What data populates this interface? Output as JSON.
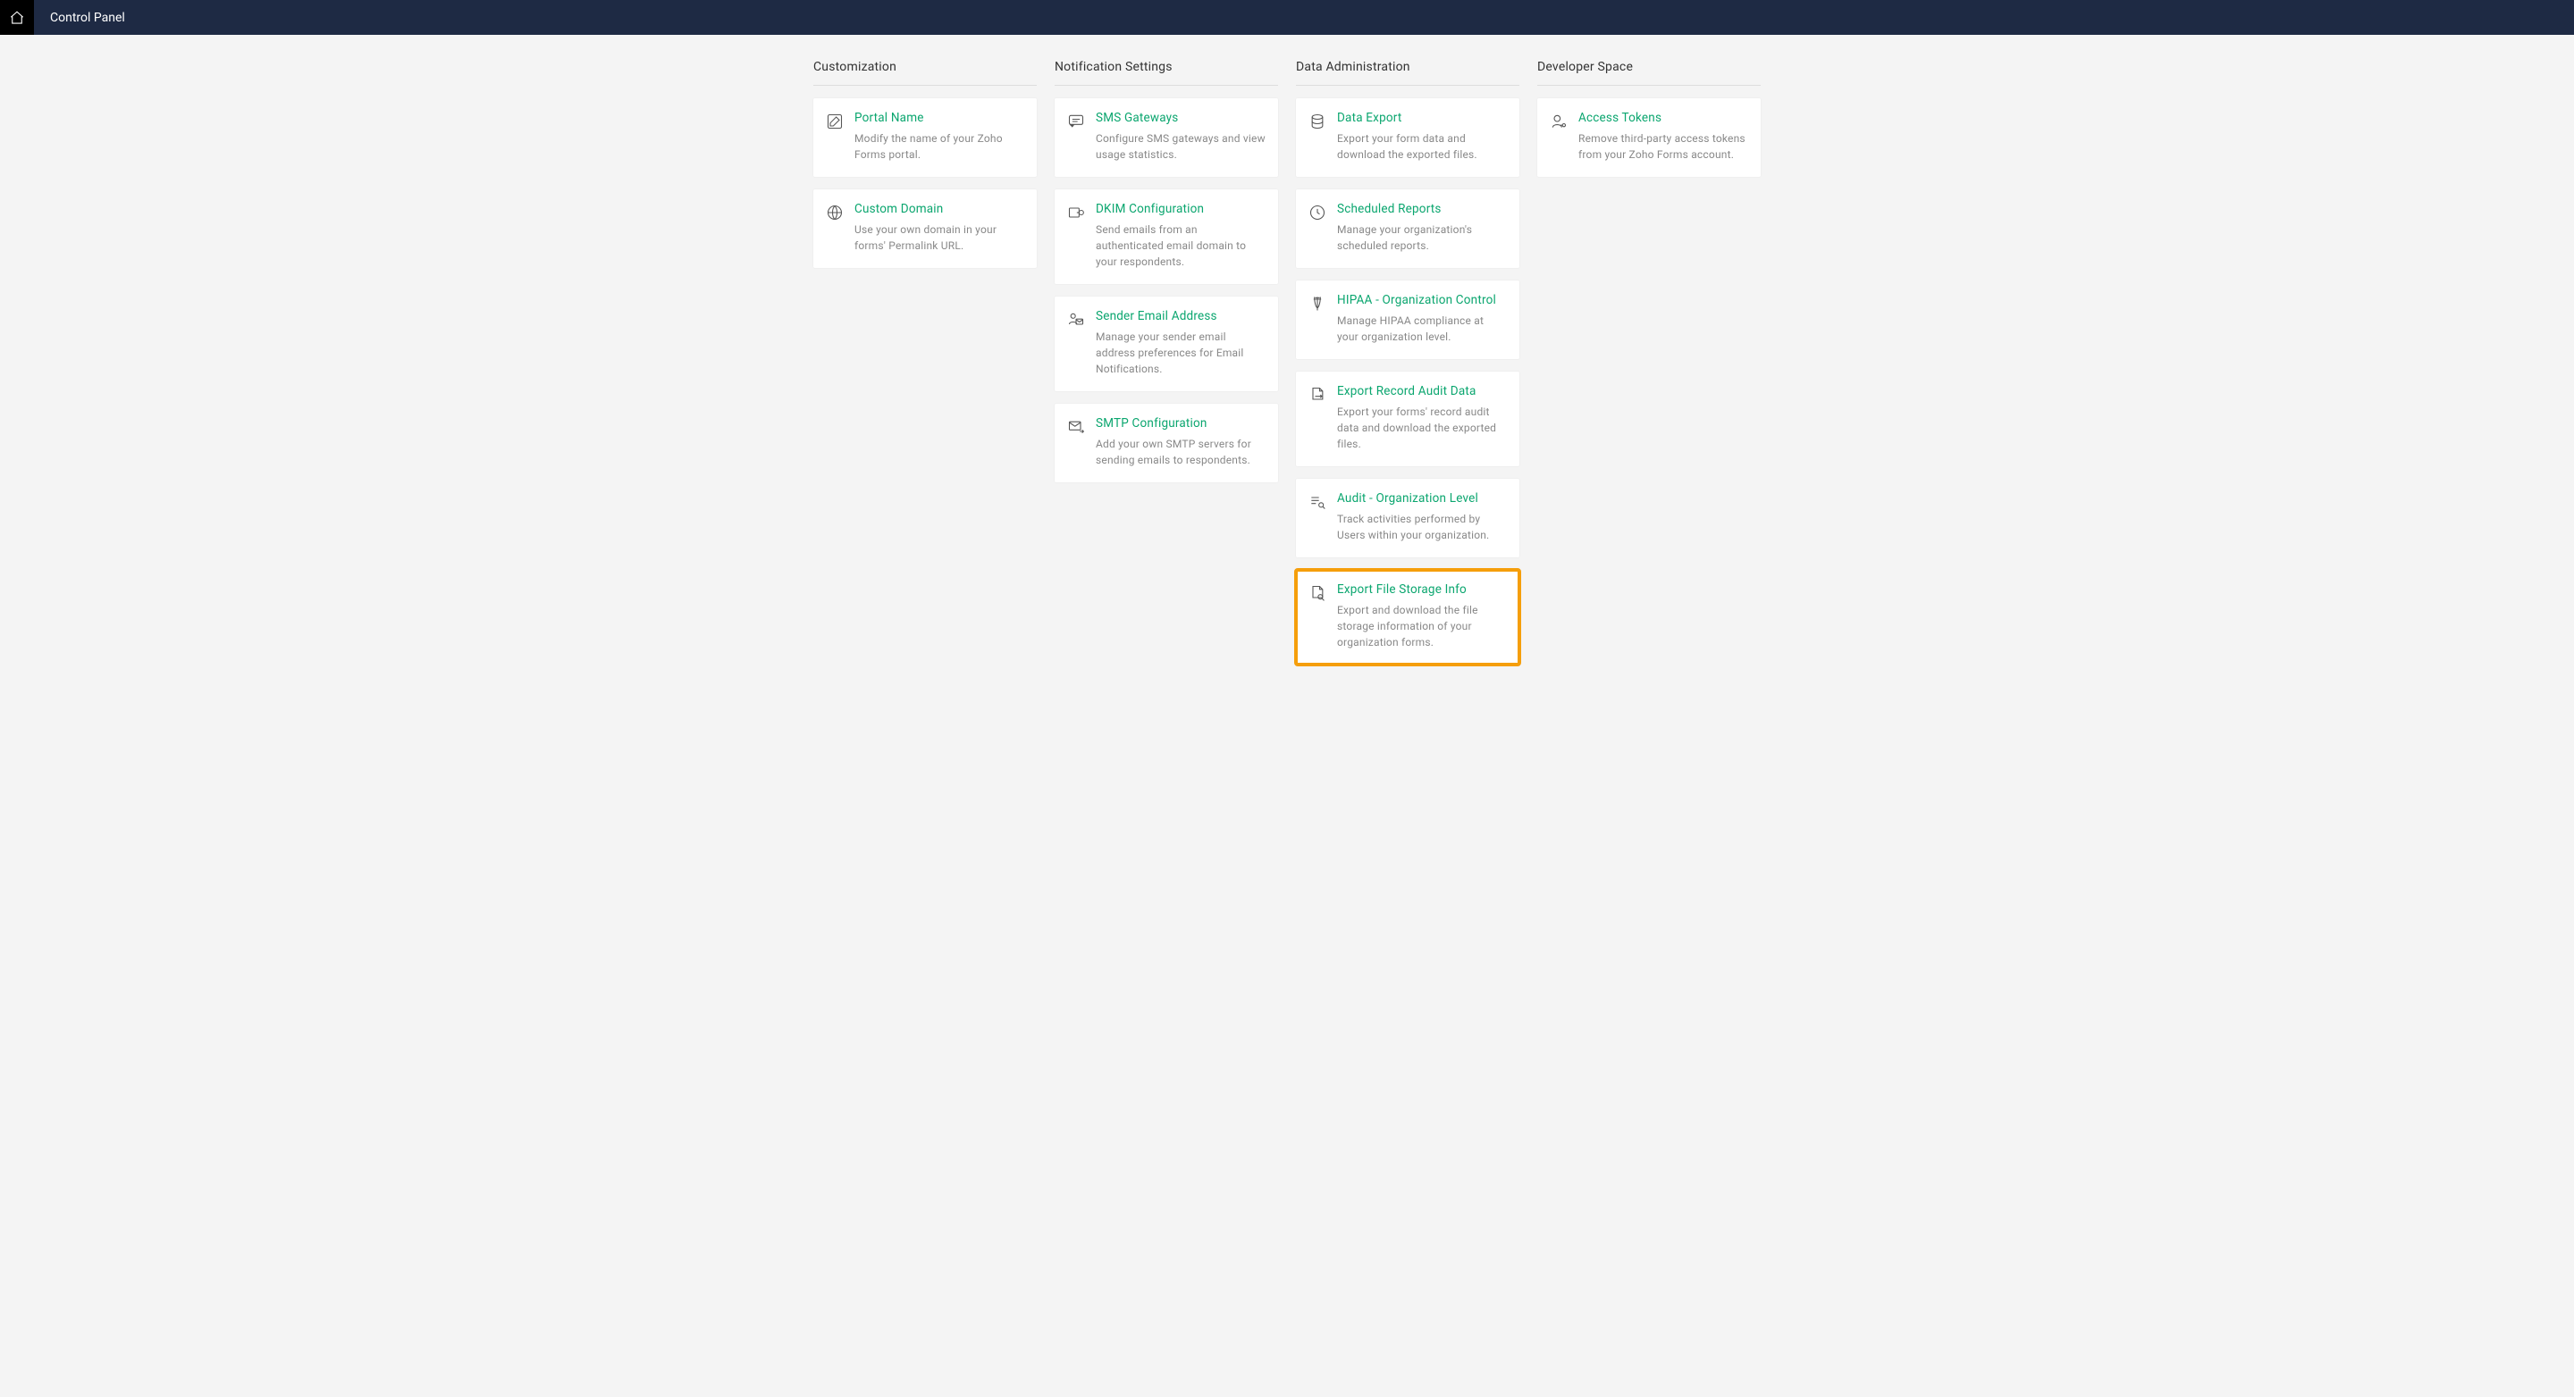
{
  "header": {
    "title": "Control Panel"
  },
  "columns": [
    {
      "heading": "Customization",
      "cards": [
        {
          "icon": "edit",
          "title": "Portal Name",
          "desc": "Modify the name of your Zoho Forms portal.",
          "highlight": false
        },
        {
          "icon": "domain",
          "title": "Custom Domain",
          "desc": "Use your own domain in your forms' Permalink URL.",
          "highlight": false
        }
      ]
    },
    {
      "heading": "Notification Settings",
      "cards": [
        {
          "icon": "sms",
          "title": "SMS Gateways",
          "desc": "Configure SMS gateways and view usage statistics.",
          "highlight": false
        },
        {
          "icon": "key",
          "title": "DKIM Configuration",
          "desc": "Send emails from an authenticated email domain to your respondents.",
          "highlight": false
        },
        {
          "icon": "user-mail",
          "title": "Sender Email Address",
          "desc": "Manage your sender email address preferences for Email Notifications.",
          "highlight": false
        },
        {
          "icon": "mail-out",
          "title": "SMTP Configuration",
          "desc": "Add your own SMTP servers for sending emails to respondents.",
          "highlight": false
        }
      ]
    },
    {
      "heading": "Data Administration",
      "cards": [
        {
          "icon": "db",
          "title": "Data Export",
          "desc": "Export your form data and download the exported files.",
          "highlight": false
        },
        {
          "icon": "clock",
          "title": "Scheduled Reports",
          "desc": "Manage your organization's scheduled reports.",
          "highlight": false
        },
        {
          "icon": "medical",
          "title": "HIPAA - Organization Control",
          "desc": "Manage HIPAA compliance at your organization level.",
          "highlight": false
        },
        {
          "icon": "doc-arrow",
          "title": "Export Record Audit Data",
          "desc": "Export your forms' record audit data and download the exported files.",
          "highlight": false
        },
        {
          "icon": "list-search",
          "title": "Audit - Organization Level",
          "desc": "Track activities performed by Users within your organization.",
          "highlight": false
        },
        {
          "icon": "doc-search",
          "title": "Export File Storage Info",
          "desc": "Export and download the file storage information of your organization forms.",
          "highlight": true
        }
      ]
    },
    {
      "heading": "Developer Space",
      "cards": [
        {
          "icon": "user-key",
          "title": "Access Tokens",
          "desc": "Remove third-party access tokens from your Zoho Forms account.",
          "highlight": false
        }
      ]
    }
  ]
}
